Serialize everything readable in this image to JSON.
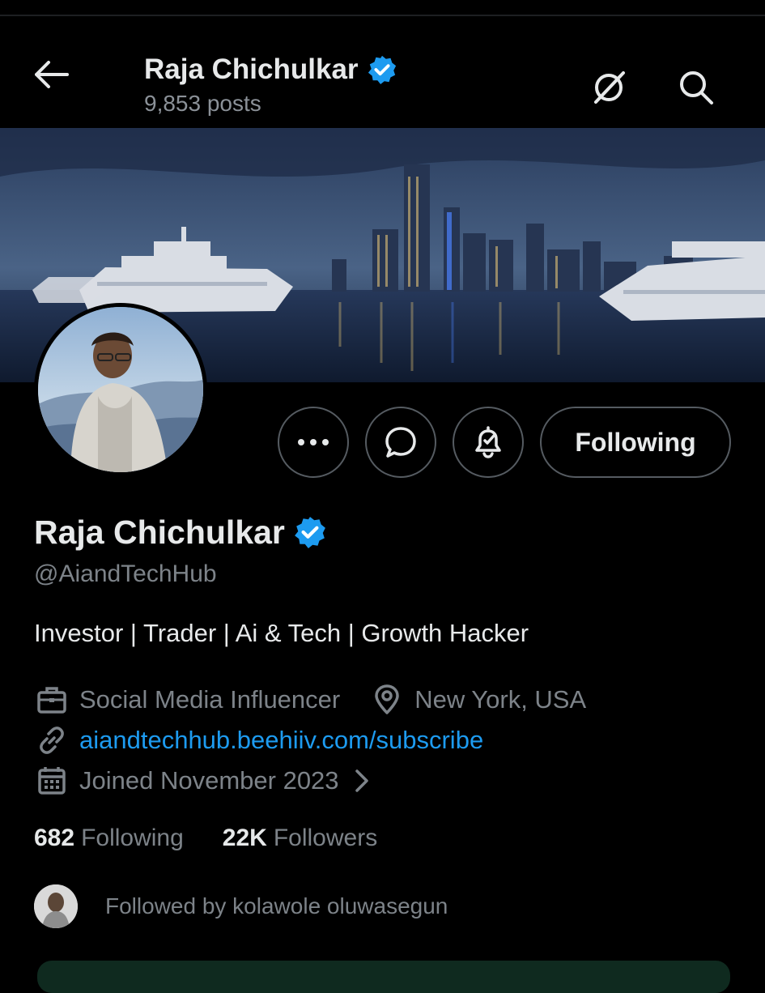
{
  "header": {
    "title": "Raja Chichulkar",
    "posts": "9,853 posts",
    "back_icon": "arrow-left-icon",
    "grok_icon": "grok-icon",
    "search_icon": "search-icon"
  },
  "profile": {
    "name": "Raja Chichulkar",
    "handle": "@AiandTechHub",
    "bio": "Investor | Trader | Ai & Tech | Growth Hacker",
    "category": "Social Media Influencer",
    "location": "New York, USA",
    "link": "aiandtechhub.beehiiv.com/subscribe",
    "joined": "Joined November 2023"
  },
  "actions": {
    "more": "more-icon",
    "message": "message-icon",
    "notify": "notification-bell-icon",
    "follow_label": "Following"
  },
  "stats": {
    "following_count": "682",
    "following_label": "Following",
    "followers_count": "22K",
    "followers_label": "Followers"
  },
  "followed_by": "Followed by kolawole oluwasegun",
  "colors": {
    "background": "#000000",
    "verified": "#1d9bf0",
    "link": "#1d9bf0",
    "muted": "#7d8389"
  }
}
